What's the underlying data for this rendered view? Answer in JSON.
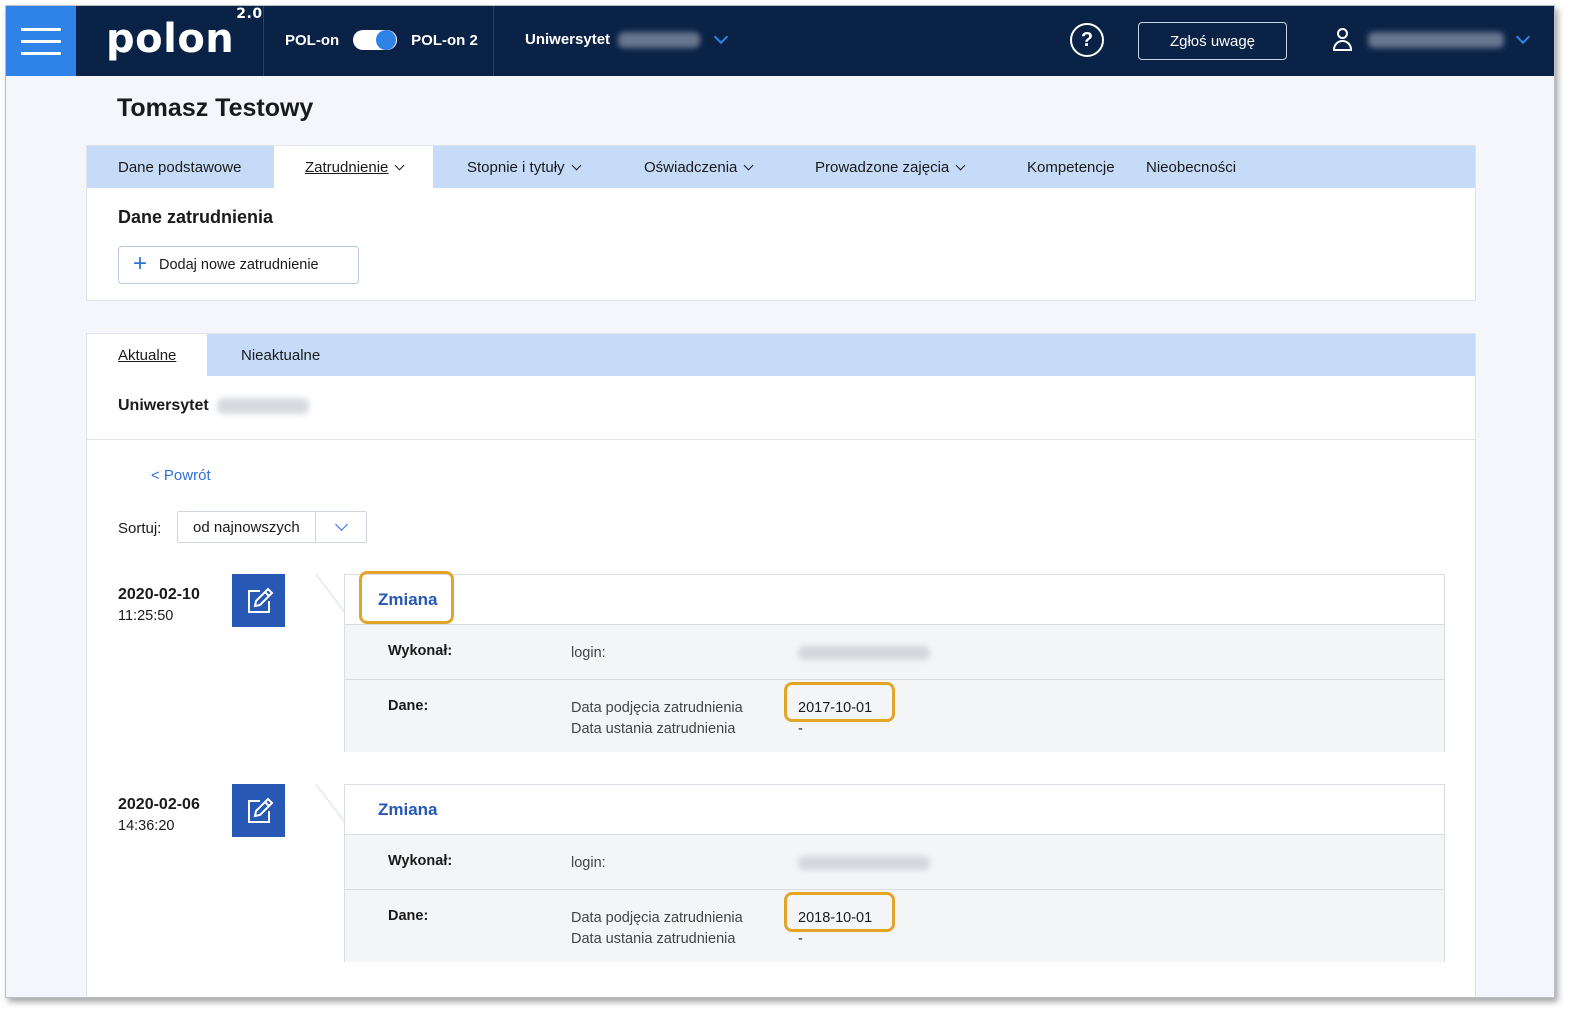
{
  "header": {
    "logo": "polon",
    "logo_version": "2.0",
    "sys_left": "POL-on",
    "sys_right": "POL-on 2",
    "university_label": "Uniwersytet",
    "help": "?",
    "report_button": "Zgłoś uwagę"
  },
  "page": {
    "title": "Tomasz Testowy"
  },
  "main_tabs": [
    {
      "label": "Dane podstawowe"
    },
    {
      "label": "Zatrudnienie"
    },
    {
      "label": "Stopnie i tytuły"
    },
    {
      "label": "Oświadczenia"
    },
    {
      "label": "Prowadzone zajęcia"
    },
    {
      "label": "Kompetencje"
    },
    {
      "label": "Nieobecności"
    }
  ],
  "employment": {
    "section_title": "Dane zatrudnienia",
    "add_button": "Dodaj nowe zatrudnienie"
  },
  "history_tabs": [
    {
      "label": "Aktualne"
    },
    {
      "label": "Nieaktualne"
    }
  ],
  "history": {
    "university_label": "Uniwersytet",
    "back_link": "< Powrót",
    "sort_label": "Sortuj:",
    "sort_value": "od najnowszych",
    "entries": [
      {
        "date": "2020-02-10",
        "time": "11:25:50",
        "type": "Zmiana",
        "performed_by_label": "Wykonał:",
        "login_label": "login:",
        "data_label": "Dane:",
        "field_start": "Data podjęcia zatrudnienia",
        "field_end": "Data ustania zatrudnienia",
        "value_start": "2017-10-01",
        "value_end": "-"
      },
      {
        "date": "2020-02-06",
        "time": "14:36:20",
        "type": "Zmiana",
        "performed_by_label": "Wykonał:",
        "login_label": "login:",
        "data_label": "Dane:",
        "field_start": "Data podjęcia zatrudnienia",
        "field_end": "Data ustania zatrudnienia",
        "value_start": "2018-10-01",
        "value_end": "-"
      }
    ]
  },
  "colors": {
    "topbar": "#0a2246",
    "accent": "#2f82e6",
    "tab_bar": "#c6dbf8",
    "link": "#2658b4",
    "highlight": "#e3a42a"
  }
}
